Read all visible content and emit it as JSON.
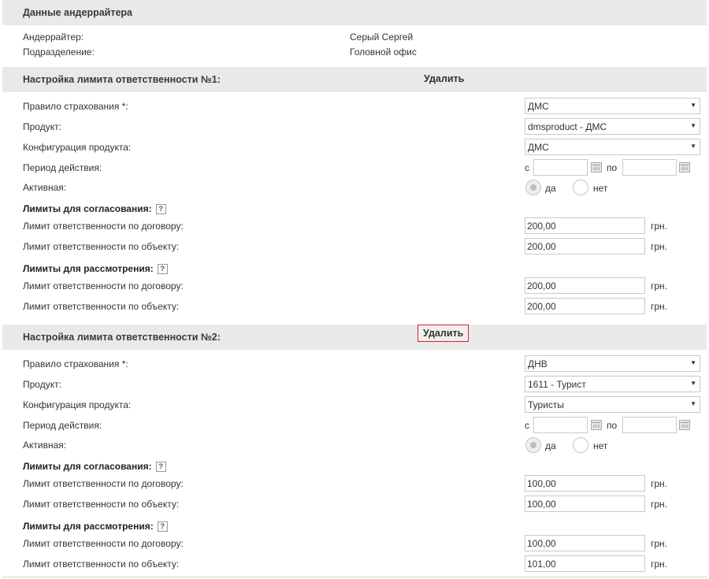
{
  "underwriter": {
    "header": "Данные андеррайтера",
    "underwriter_label": "Андеррайтер:",
    "underwriter_value": "Серый Сергей",
    "division_label": "Подразделение:",
    "division_value": "Головной офис"
  },
  "labels": {
    "rule": "Правило страхования *:",
    "product": "Продукт:",
    "config": "Конфигурация продукта:",
    "period": "Период действия:",
    "active": "Активная:",
    "limits_approval": "Лимиты для согласования:",
    "limits_review": "Лимиты для рассмотрения:",
    "limit_contract": "Лимит ответственности по договору:",
    "limit_object": "Лимит ответственности по объекту:",
    "from": "с",
    "to": "по",
    "yes": "да",
    "no": "нет",
    "currency": "грн.",
    "delete": "Удалить",
    "help": "?"
  },
  "limit1": {
    "title": "Настройка лимита ответственности №1:",
    "rule": "ДМС",
    "product": "dmsproduct - ДМС",
    "config": "ДМС",
    "approval_contract": "200,00",
    "approval_object": "200,00",
    "review_contract": "200,00",
    "review_object": "200,00"
  },
  "limit2": {
    "title": "Настройка лимита ответственности №2:",
    "rule": "ДНВ",
    "product": "1611 - Турист",
    "config": "Туристы",
    "approval_contract": "100,00",
    "approval_object": "100,00",
    "review_contract": "100,00",
    "review_object": "101,00"
  }
}
